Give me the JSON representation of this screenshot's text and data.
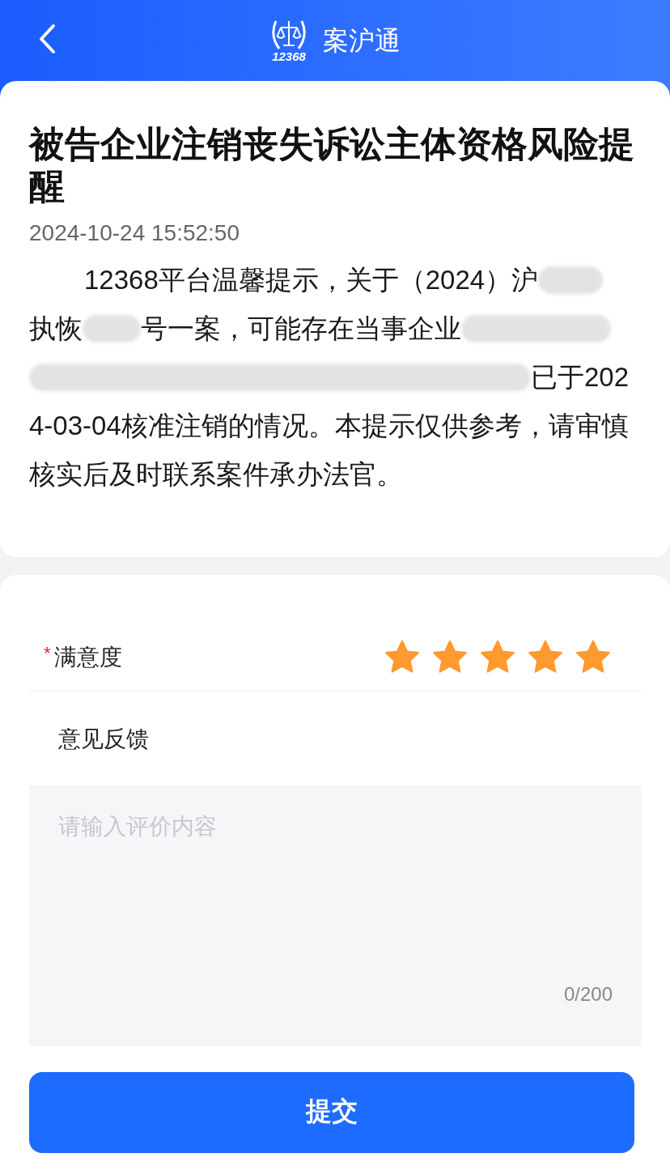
{
  "header": {
    "logo_text": "12368",
    "title": "案沪通"
  },
  "notice": {
    "title": "被告企业注销丧失诉讼主体资格风险提醒",
    "time": "2024-10-24 15:52:50",
    "body_lines": [
      [
        {
          "kind": "text",
          "text": "12368平台温馨提示，关于（2024）沪"
        },
        {
          "kind": "redacted"
        }
      ],
      [
        {
          "kind": "text",
          "text": "执恢"
        },
        {
          "kind": "redacted"
        },
        {
          "kind": "text",
          "text": "号一案，可能存在当事企业"
        },
        {
          "kind": "redacted"
        }
      ],
      [
        {
          "kind": "redacted"
        },
        {
          "kind": "text",
          "text": "已于202"
        }
      ],
      [
        {
          "kind": "text",
          "text": "4-03-04核准注销的情况。本提示仅供参考，请审慎核实后及时联系案件承办法官。"
        }
      ]
    ]
  },
  "form": {
    "rating": {
      "required_mark": "*",
      "label": "满意度",
      "stars": 5
    },
    "feedback": {
      "label": "意见反馈",
      "placeholder": "请输入评价内容",
      "counter": "0/200"
    },
    "submit": "提交"
  }
}
